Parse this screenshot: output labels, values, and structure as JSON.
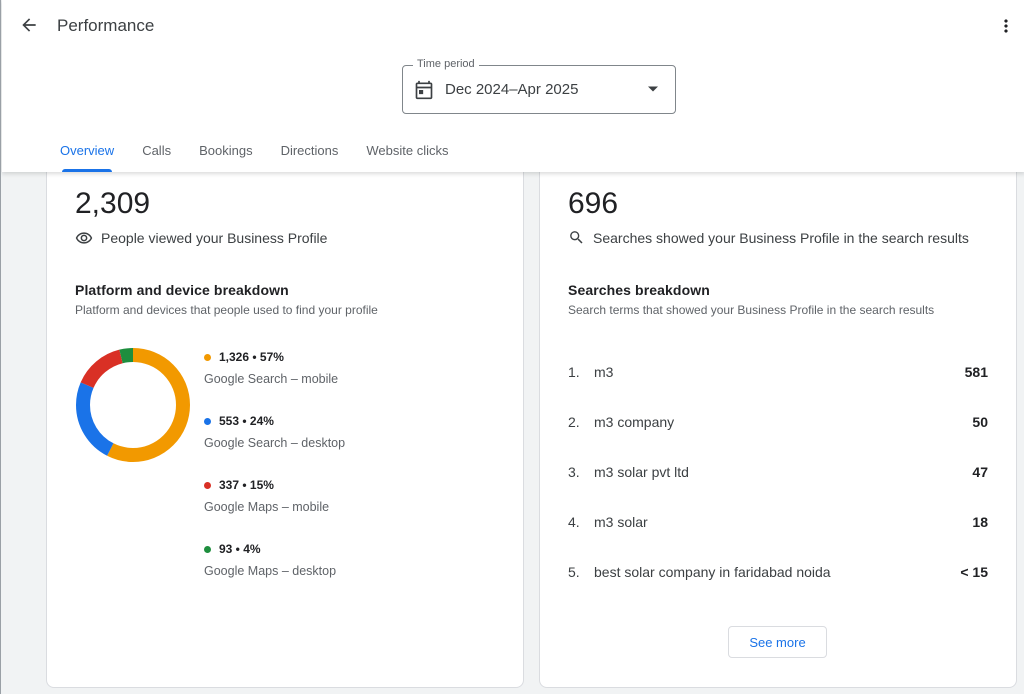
{
  "header": {
    "title": "Performance"
  },
  "time_period": {
    "label": "Time period",
    "value": "Dec 2024–Apr 2025"
  },
  "tabs": [
    {
      "label": "Overview"
    },
    {
      "label": "Calls"
    },
    {
      "label": "Bookings"
    },
    {
      "label": "Directions"
    },
    {
      "label": "Website clicks"
    }
  ],
  "profile_views": {
    "number": "2,309",
    "caption": "People viewed your Business Profile",
    "icon": "eye-icon"
  },
  "platform": {
    "title": "Platform and device breakdown",
    "subtitle": "Platform and devices that people used to find your profile",
    "items": [
      {
        "stat": "1,326 • 57%",
        "label": "Google Search – mobile",
        "color": "#f29900",
        "value": 1326
      },
      {
        "stat": "553 • 24%",
        "label": "Google Search – desktop",
        "color": "#1a73e8",
        "value": 553
      },
      {
        "stat": "337 • 15%",
        "label": "Google Maps – mobile",
        "color": "#d93025",
        "value": 337
      },
      {
        "stat": "93 • 4%",
        "label": "Google Maps – desktop",
        "color": "#1e8e3e",
        "value": 93
      }
    ]
  },
  "searches": {
    "number": "696",
    "caption": "Searches showed your Business Profile in the search results",
    "icon": "search-icon",
    "title": "Searches breakdown",
    "subtitle": "Search terms that showed your Business Profile in the search results",
    "items": [
      {
        "rank": "1.",
        "term": "m3",
        "count": "581"
      },
      {
        "rank": "2.",
        "term": "m3 company",
        "count": "50"
      },
      {
        "rank": "3.",
        "term": "m3 solar pvt ltd",
        "count": "47"
      },
      {
        "rank": "4.",
        "term": "m3 solar",
        "count": "18"
      },
      {
        "rank": "5.",
        "term": "best solar company in faridabad noida",
        "count": "< 15"
      }
    ],
    "see_more": "See more"
  }
}
